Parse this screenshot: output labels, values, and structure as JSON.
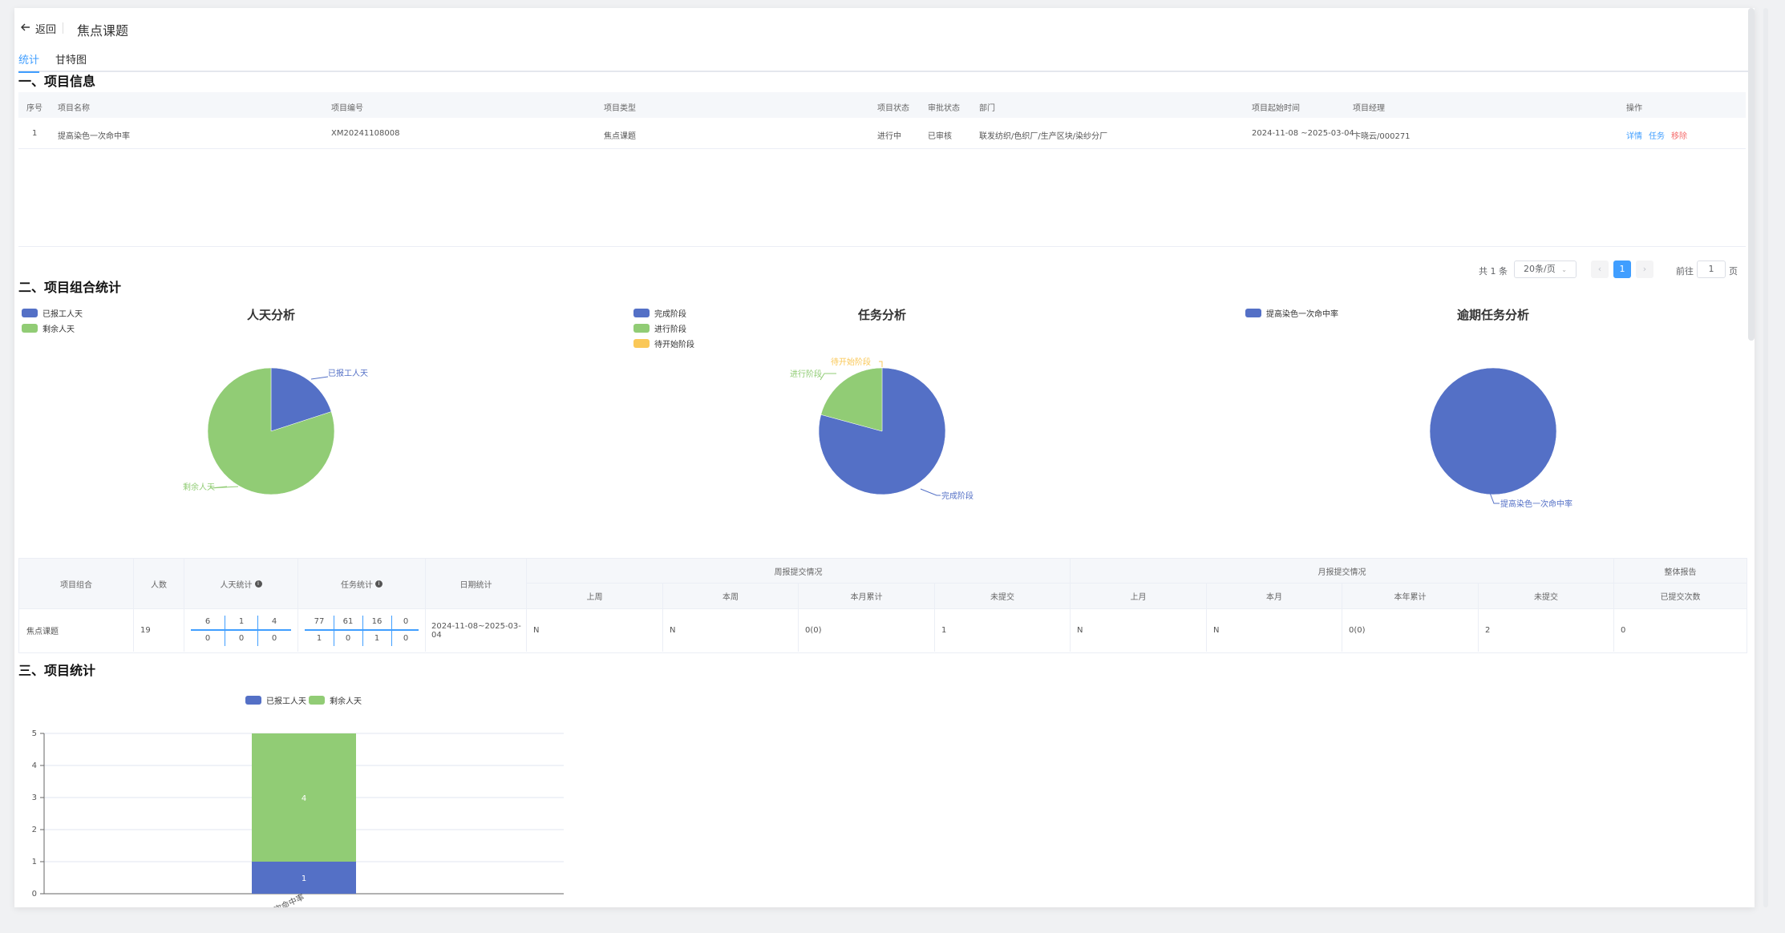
{
  "header": {
    "back_label": "返回",
    "title": "焦点课题"
  },
  "tabs": [
    {
      "label": "统计",
      "active": true
    },
    {
      "label": "甘特图",
      "active": false
    }
  ],
  "section1": {
    "title": "一、项目信息",
    "columns": [
      "序号",
      "项目名称",
      "项目编号",
      "项目类型",
      "项目状态",
      "审批状态",
      "部门",
      "项目起始时间",
      "项目经理",
      "操作"
    ],
    "rows": [
      {
        "index": "1",
        "name": "提高染色一次命中率",
        "code": "XM20241108008",
        "type": "焦点课题",
        "status": "进行中",
        "approval": "已审核",
        "dept": "联发纺织/色织厂/生产区块/染纱分厂",
        "period": "2024-11-08 ~2025-03-04",
        "manager": "卞晓云/000271",
        "actions": [
          "详情",
          "任务",
          "移除"
        ]
      }
    ]
  },
  "pagination": {
    "total": "共 1 条",
    "page_size": "20条/页",
    "current": "1",
    "goto_label": "前往",
    "goto_value": "1",
    "page_unit": "页"
  },
  "section2": {
    "title": "二、项目组合统计",
    "charts": [
      {
        "title": "人天分析",
        "legend": [
          {
            "name": "已报工人天",
            "color": "#5470c6"
          },
          {
            "name": "剩余人天",
            "color": "#91cc75"
          }
        ],
        "labels": [
          "已报工人天",
          "剩余人天"
        ]
      },
      {
        "title": "任务分析",
        "legend": [
          {
            "name": "完成阶段",
            "color": "#5470c6"
          },
          {
            "name": "进行阶段",
            "color": "#91cc75"
          },
          {
            "name": "待开始阶段",
            "color": "#fac858"
          }
        ],
        "labels": [
          "完成阶段",
          "进行阶段",
          "待开始阶段"
        ]
      },
      {
        "title": "逾期任务分析",
        "legend": [
          {
            "name": "提高染色一次命中率",
            "color": "#5470c6"
          }
        ],
        "labels": [
          "提高染色一次命中率"
        ]
      }
    ]
  },
  "chart_data": [
    {
      "type": "pie",
      "title": "人天分析",
      "categories": [
        "已报工人天",
        "剩余人天"
      ],
      "values": [
        1,
        4
      ]
    },
    {
      "type": "pie",
      "title": "任务分析",
      "categories": [
        "完成阶段",
        "进行阶段",
        "待开始阶段"
      ],
      "values": [
        61,
        16,
        0
      ]
    },
    {
      "type": "pie",
      "title": "逾期任务分析",
      "categories": [
        "提高染色一次命中率"
      ],
      "values": [
        1
      ]
    },
    {
      "type": "bar",
      "title": "",
      "categories": [
        "提高染色一次命中率"
      ],
      "series": [
        {
          "name": "已报工人天",
          "values": [
            1
          ],
          "color": "#5470c6"
        },
        {
          "name": "剩余人天",
          "values": [
            4
          ],
          "color": "#91cc75"
        }
      ],
      "yticks": [
        "0",
        "1",
        "2",
        "3",
        "4",
        "5"
      ],
      "ylim": [
        0,
        5
      ],
      "x_tick_label": "次命中率",
      "stacked": true,
      "grid": true,
      "legend": "top"
    }
  ],
  "group_table": {
    "headers": {
      "group": "项目组合",
      "people": "人数",
      "manday": "人天统计",
      "task": "任务统计",
      "date": "日期统计",
      "weekly": "周报提交情况",
      "monthly": "月报提交情况",
      "overall": "整体报告"
    },
    "weekly_sub": [
      "上周",
      "本周",
      "本月累计",
      "未提交"
    ],
    "monthly_sub": [
      "上月",
      "本月",
      "本年累计",
      "未提交"
    ],
    "overall_sub": [
      "已提交次数"
    ],
    "row": {
      "group": "焦点课题",
      "people": "19",
      "manday_top": [
        "6",
        "1",
        "4"
      ],
      "manday_bottom": [
        "0",
        "0",
        "0"
      ],
      "task_top": [
        "77",
        "61",
        "16",
        "0"
      ],
      "task_bottom": [
        "1",
        "0",
        "1",
        "0"
      ],
      "date": "2024-11-08~2025-03-04",
      "weekly": [
        "N",
        "N",
        "0(0)",
        "1"
      ],
      "monthly": [
        "N",
        "N",
        "0(0)",
        "2"
      ],
      "overall": [
        "0"
      ]
    }
  },
  "section3": {
    "title": "三、项目统计",
    "legend": [
      {
        "name": "已报工人天",
        "color": "#5470c6"
      },
      {
        "name": "剩余人天",
        "color": "#91cc75"
      }
    ]
  }
}
